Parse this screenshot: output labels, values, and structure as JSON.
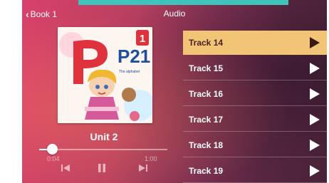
{
  "navbar": {
    "back_label": "Book 1",
    "title": "Audio"
  },
  "cover": {
    "badge_number": "1",
    "logo_text": "P21",
    "logo_subtext": "The alphabet"
  },
  "player": {
    "unit_title": "Unit 2",
    "current_time": "0:04",
    "total_time": "1:00",
    "progress": 0.1
  },
  "tracks": [
    {
      "label": "Track 14",
      "active": true
    },
    {
      "label": "Track 15",
      "active": false
    },
    {
      "label": "Track 16",
      "active": false
    },
    {
      "label": "Track 17",
      "active": false
    },
    {
      "label": "Track 18",
      "active": false
    },
    {
      "label": "Track 19",
      "active": false
    }
  ],
  "colors": {
    "accent": "#f2c476",
    "banner": "#3ec4bb",
    "background_start": "#d9416a",
    "background_end": "#4a2238"
  }
}
